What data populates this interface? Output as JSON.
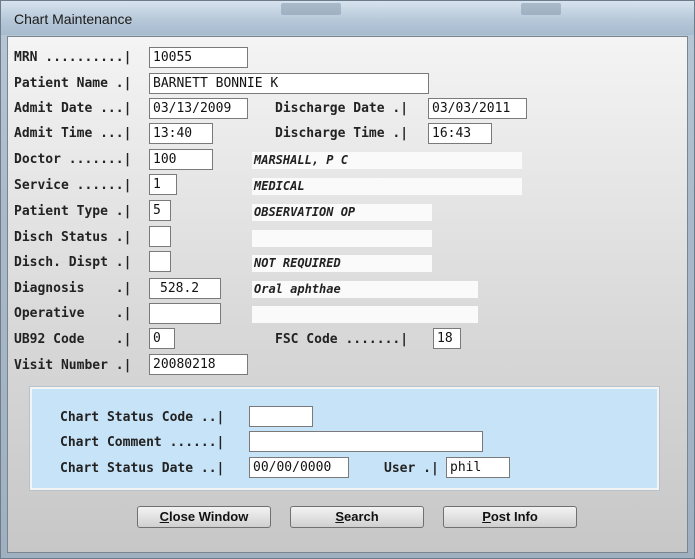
{
  "window": {
    "title": "Chart Maintenance"
  },
  "form": {
    "mrn": {
      "label": "MRN ..........|",
      "value": "10055"
    },
    "patient_name": {
      "label": "Patient Name .|",
      "value": "BARNETT BONNIE K"
    },
    "admit_date": {
      "label": "Admit Date ...|",
      "value": "03/13/2009"
    },
    "discharge_date": {
      "label": "Discharge Date .|",
      "value": "03/03/2011"
    },
    "admit_time": {
      "label": "Admit Time ...|",
      "value": "13:40"
    },
    "discharge_time": {
      "label": "Discharge Time .|",
      "value": "16:43"
    },
    "doctor": {
      "label": "Doctor .......|",
      "value": "100",
      "name": "MARSHALL, P C"
    },
    "service": {
      "label": "Service ......|",
      "value": "1",
      "name": "MEDICAL"
    },
    "patient_type": {
      "label": "Patient Type .|",
      "value": "5",
      "name": "OBSERVATION OP"
    },
    "disch_status": {
      "label": "Disch Status .|",
      "value": "",
      "name": ""
    },
    "disch_dispt": {
      "label": "Disch. Dispt .|",
      "value": "",
      "name": "NOT REQUIRED"
    },
    "diagnosis": {
      "label": "Diagnosis    .|",
      "value": "528.2",
      "name": "Oral aphthae"
    },
    "operative": {
      "label": "Operative    .|",
      "value": "",
      "name": ""
    },
    "ub92_code": {
      "label": "UB92 Code    .|",
      "value": "0"
    },
    "fsc_code": {
      "label": "FSC Code .......|",
      "value": "18"
    },
    "visit_number": {
      "label": "Visit Number .|",
      "value": "20080218"
    }
  },
  "chart_status": {
    "code": {
      "label": "Chart Status Code ..|",
      "value": ""
    },
    "comment": {
      "label": "Chart Comment ......|",
      "value": ""
    },
    "date": {
      "label": "Chart Status Date ..|",
      "value": "00/00/0000"
    },
    "user": {
      "label": "User .|",
      "value": "phil"
    }
  },
  "buttons": {
    "close": {
      "mnemonic": "C",
      "rest": "lose Window"
    },
    "search": {
      "mnemonic": "S",
      "rest": "earch"
    },
    "post": {
      "mnemonic": "P",
      "rest": "ost Info"
    }
  }
}
